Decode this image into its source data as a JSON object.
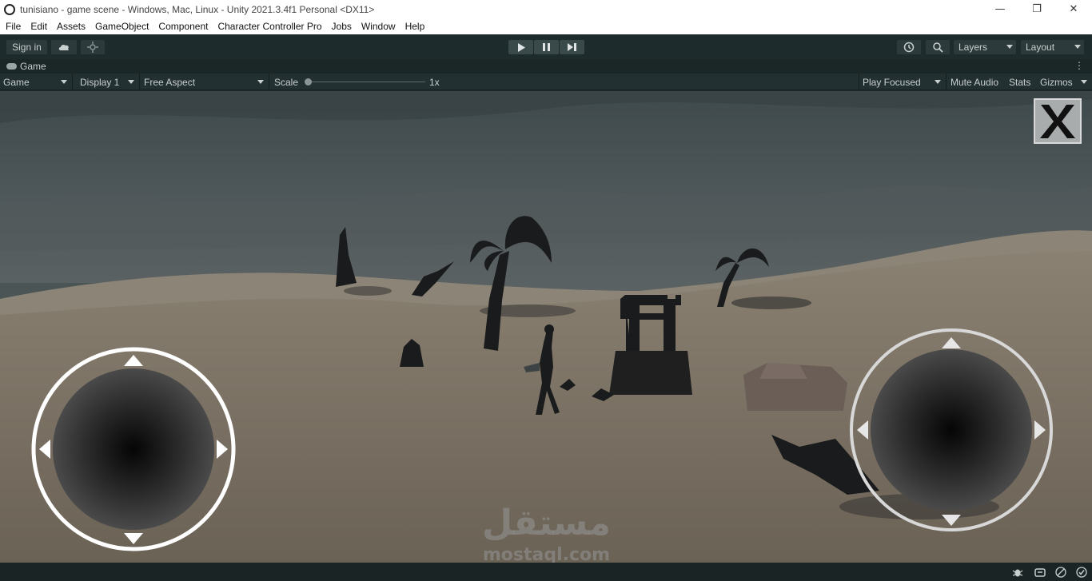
{
  "window": {
    "title": "tunisiano - game scene - Windows, Mac, Linux - Unity 2021.3.4f1 Personal <DX11>",
    "minimize_glyph": "—",
    "maximize_glyph": "❐",
    "close_glyph": "✕"
  },
  "menu": [
    "File",
    "Edit",
    "Assets",
    "GameObject",
    "Component",
    "Character Controller Pro",
    "Jobs",
    "Window",
    "Help"
  ],
  "toolbar": {
    "sign_in": "Sign in",
    "cloud_icon": "cloud-icon",
    "collab_icon": "collab-icon",
    "play_icon": "play-icon",
    "pause_icon": "pause-icon",
    "step_icon": "step-icon",
    "history_icon": "history-icon",
    "search_icon": "search-icon",
    "layers": "Layers",
    "layout": "Layout"
  },
  "tab": {
    "label": "Game",
    "more": "⋮"
  },
  "gamebar": {
    "mode": "Game",
    "display": "Display 1",
    "aspect": "Free Aspect",
    "scale_label": "Scale",
    "scale_value": "1x",
    "play_focused": "Play Focused",
    "mute_audio": "Mute Audio",
    "stats": "Stats",
    "gizmos": "Gizmos"
  },
  "viewport": {
    "close_button": "X",
    "watermark_ar": "مستقل",
    "watermark_en": "mostaql.com"
  },
  "colors": {
    "editor_bg": "#1d2b2c",
    "sand": "#7f7466",
    "sky": "#4d5558",
    "joystick_ring": "#ffffff"
  }
}
